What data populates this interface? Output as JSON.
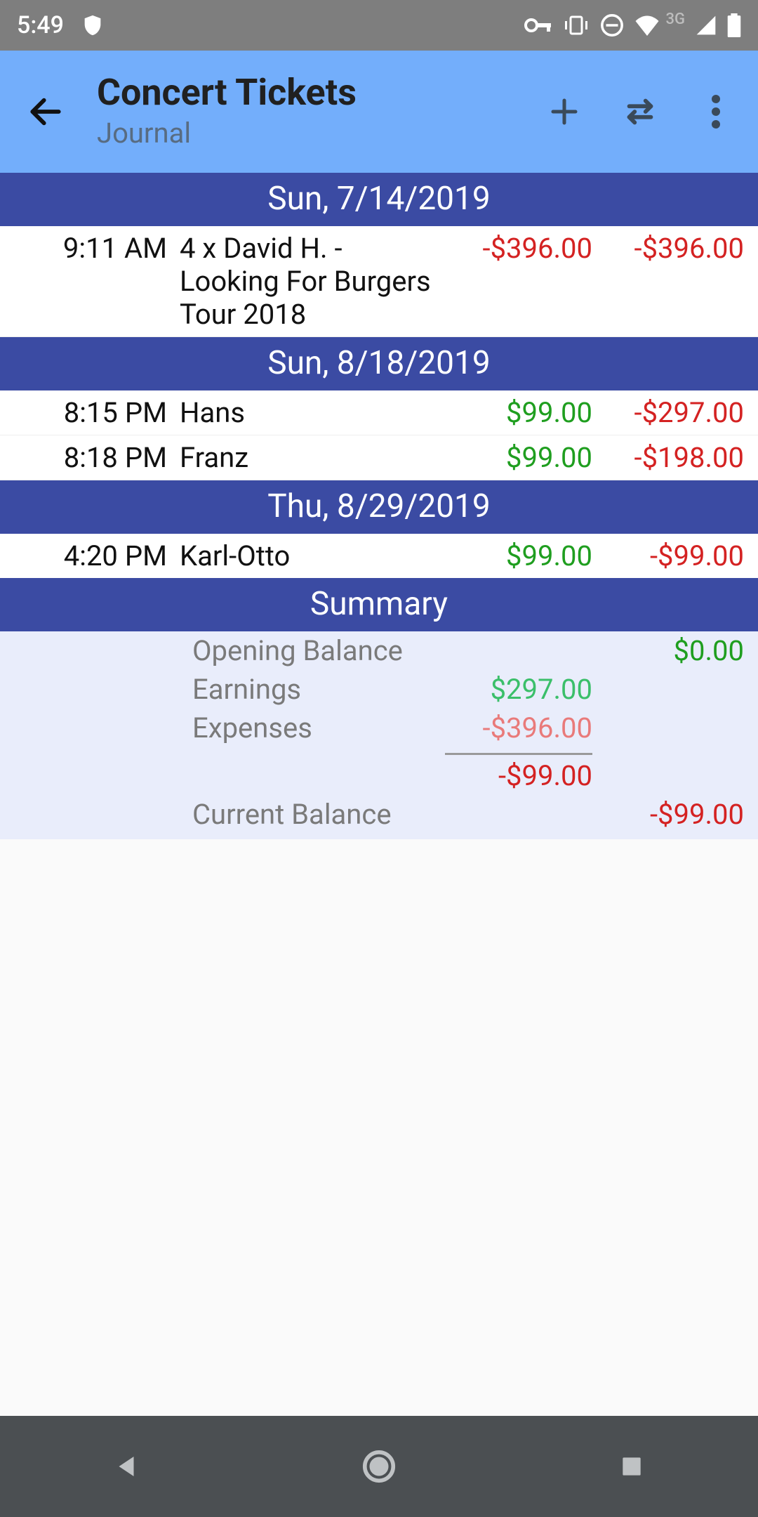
{
  "status": {
    "time": "5:49",
    "network_label": "3G"
  },
  "appbar": {
    "title": "Concert Tickets",
    "subtitle": "Journal"
  },
  "sections": [
    {
      "header": "Sun, 7/14/2019",
      "rows": [
        {
          "time": "9:11 AM",
          "desc": "4 x David H. - Looking For Burgers Tour 2018",
          "amount": "-$396.00",
          "amount_sign": "neg",
          "balance": "-$396.00",
          "balance_sign": "neg"
        }
      ]
    },
    {
      "header": "Sun, 8/18/2019",
      "rows": [
        {
          "time": "8:15 PM",
          "desc": "Hans",
          "amount": "$99.00",
          "amount_sign": "pos",
          "balance": "-$297.00",
          "balance_sign": "neg"
        },
        {
          "time": "8:18 PM",
          "desc": "Franz",
          "amount": "$99.00",
          "amount_sign": "pos",
          "balance": "-$198.00",
          "balance_sign": "neg"
        }
      ]
    },
    {
      "header": "Thu, 8/29/2019",
      "rows": [
        {
          "time": "4:20 PM",
          "desc": "Karl-Otto",
          "amount": "$99.00",
          "amount_sign": "pos",
          "balance": "-$99.00",
          "balance_sign": "neg"
        }
      ]
    }
  ],
  "summary": {
    "header": "Summary",
    "opening_label": "Opening Balance",
    "opening_value": "$0.00",
    "earnings_label": "Earnings",
    "earnings_value": "$297.00",
    "expenses_label": "Expenses",
    "expenses_value": "-$396.00",
    "net_value": "-$99.00",
    "current_label": "Current Balance",
    "current_value": "-$99.00"
  }
}
